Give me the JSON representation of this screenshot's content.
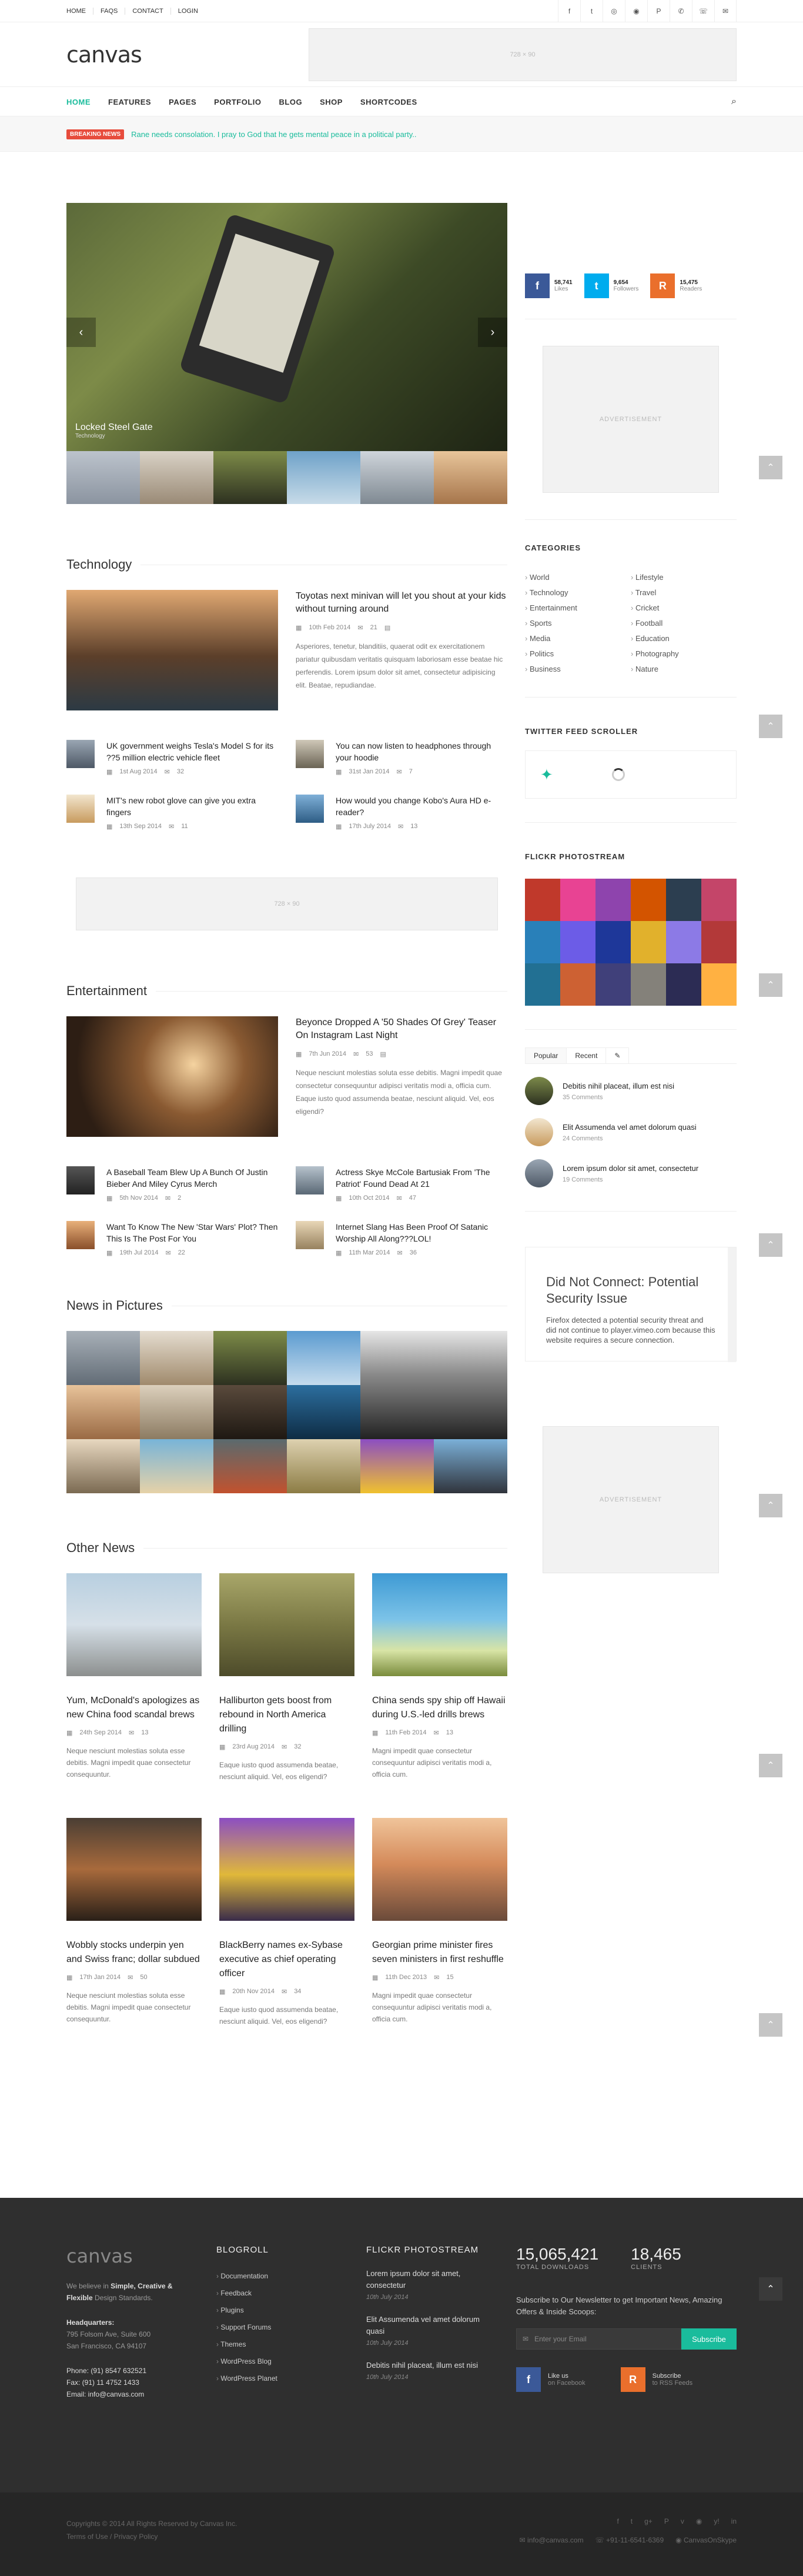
{
  "topnav": [
    "HOME",
    "FAQS",
    "CONTACT",
    "LOGIN"
  ],
  "social_icons": [
    "f",
    "t",
    "◎",
    "◉",
    "P",
    "✆",
    "☏",
    "✉"
  ],
  "logo": "canvas",
  "header_ad": "728 × 90",
  "menu": [
    "HOME",
    "FEATURES",
    "PAGES",
    "PORTFOLIO",
    "BLOG",
    "SHOP",
    "SHORTCODES"
  ],
  "breaking": {
    "badge": "BREAKING NEWS",
    "text": "Rane needs consolation. I pray to God that he gets mental peace in a political party.."
  },
  "slider": {
    "title": "Locked Steel Gate",
    "category": "Technology"
  },
  "technology": {
    "title": "Technology",
    "featured": {
      "title": "Toyotas next minivan will let you shout at your kids without turning around",
      "date": "10th Feb 2014",
      "comments": "21",
      "excerpt": "Asperiores, tenetur, blanditiis, quaerat odit ex exercitationem pariatur quibusdam veritatis quisquam laboriosam esse beatae hic perferendis. Lorem ipsum dolor sit amet, consectetur adipisicing elit. Beatae, repudiandae."
    },
    "posts": [
      {
        "title": "UK government weighs Tesla's Model S for its ??5 million electric vehicle fleet",
        "date": "1st Aug 2014",
        "comments": "32"
      },
      {
        "title": "You can now listen to headphones through your hoodie",
        "date": "31st Jan 2014",
        "comments": "7"
      },
      {
        "title": "MIT's new robot glove can give you extra fingers",
        "date": "13th Sep 2014",
        "comments": "11"
      },
      {
        "title": "How would you change Kobo's Aura HD e-reader?",
        "date": "17th July 2014",
        "comments": "13"
      }
    ]
  },
  "mid_ad": "728 × 90",
  "entertainment": {
    "title": "Entertainment",
    "featured": {
      "title": "Beyonce Dropped A '50 Shades Of Grey' Teaser On Instagram Last Night",
      "date": "7th Jun 2014",
      "comments": "53",
      "excerpt": "Neque nesciunt molestias soluta esse debitis. Magni impedit quae consectetur consequuntur adipisci veritatis modi a, officia cum. Eaque iusto quod assumenda beatae, nesciunt aliquid. Vel, eos eligendi?"
    },
    "posts": [
      {
        "title": "A Baseball Team Blew Up A Bunch Of Justin Bieber And Miley Cyrus Merch",
        "date": "5th Nov 2014",
        "comments": "2"
      },
      {
        "title": "Actress Skye McCole Bartusiak From 'The Patriot' Found Dead At 21",
        "date": "10th Oct 2014",
        "comments": "47"
      },
      {
        "title": "Want To Know The New 'Star Wars' Plot? Then This Is The Post For You",
        "date": "19th Jul 2014",
        "comments": "22"
      },
      {
        "title": "Internet Slang Has Been Proof Of Satanic Worship All Along???LOL!",
        "date": "11th Mar 2014",
        "comments": "36"
      }
    ]
  },
  "pictures": {
    "title": "News in Pictures"
  },
  "other_news": {
    "title": "Other News",
    "posts": [
      {
        "title": "Yum, McDonald's apologizes as new China food scandal brews",
        "date": "24th Sep 2014",
        "comments": "13",
        "excerpt": "Neque nesciunt molestias soluta esse debitis. Magni impedit quae consectetur consequuntur."
      },
      {
        "title": "Halliburton gets boost from rebound in North America drilling",
        "date": "23rd Aug 2014",
        "comments": "32",
        "excerpt": "Eaque iusto quod assumenda beatae, nesciunt aliquid. Vel, eos eligendi?"
      },
      {
        "title": "China sends spy ship off Hawaii during U.S.-led drills brews",
        "date": "11th Feb 2014",
        "comments": "13",
        "excerpt": "Magni impedit quae consectetur consequuntur adipisci veritatis modi a, officia cum."
      },
      {
        "title": "Wobbly stocks underpin yen and Swiss franc; dollar subdued",
        "date": "17th Jan 2014",
        "comments": "50",
        "excerpt": "Neque nesciunt molestias soluta esse debitis. Magni impedit quae consectetur consequuntur."
      },
      {
        "title": "BlackBerry names ex-Sybase executive as chief operating officer",
        "date": "20th Nov 2014",
        "comments": "34",
        "excerpt": "Eaque iusto quod assumenda beatae, nesciunt aliquid. Vel, eos eligendi?"
      },
      {
        "title": "Georgian prime minister fires seven ministers in first reshuffle",
        "date": "11th Dec 2013",
        "comments": "15",
        "excerpt": "Magni impedit quae consectetur consequuntur adipisci veritatis modi a, officia cum."
      }
    ]
  },
  "sidebar": {
    "counters": [
      {
        "icon": "f",
        "num": "58,741",
        "label": "Likes",
        "color": "#3b5998"
      },
      {
        "icon": "t",
        "num": "9,654",
        "label": "Followers",
        "color": "#00acee"
      },
      {
        "icon": "R",
        "num": "15,475",
        "label": "Readers",
        "color": "#ea6f2c"
      }
    ],
    "ad": "ADVERTISEMENT",
    "categories_title": "CATEGORIES",
    "categories": [
      "World",
      "Lifestyle",
      "Technology",
      "Travel",
      "Entertainment",
      "Cricket",
      "Sports",
      "Football",
      "Media",
      "Education",
      "Politics",
      "Photography",
      "Business",
      "Nature"
    ],
    "twitter_title": "TWITTER FEED SCROLLER",
    "flickr_title": "FLICKR PHOTOSTREAM",
    "tabs": [
      "Popular",
      "Recent",
      "✎"
    ],
    "tab_posts": [
      {
        "title": "Debitis nihil placeat, illum est nisi",
        "comments": "35 Comments"
      },
      {
        "title": "Elit Assumenda vel amet dolorum quasi",
        "comments": "24 Comments"
      },
      {
        "title": "Lorem ipsum dolor sit amet, consectetur",
        "comments": "19 Comments"
      }
    ],
    "video": {
      "title": "Did Not Connect: Potential Security Issue",
      "desc": "Firefox detected a potential security threat and did not continue to player.vimeo.com because this website requires a secure connection."
    },
    "ad2": "ADVERTISEMENT"
  },
  "footer": {
    "logo": "canvas",
    "about_pre": "We believe in",
    "about_bold": "Simple, Creative & Flexible",
    "about_post": "Design Standards.",
    "hq_label": "Headquarters:",
    "address1": "795 Folsom Ave, Suite 600",
    "address2": "San Francisco, CA 94107",
    "phone": "Phone: (91) 8547 632521",
    "fax": "Fax: (91) 11 4752 1433",
    "email": "Email: info@canvas.com",
    "blogroll_title": "BLOGROLL",
    "blogroll": [
      "Documentation",
      "Feedback",
      "Plugins",
      "Support Forums",
      "Themes",
      "WordPress Blog",
      "WordPress Planet"
    ],
    "flickr_title": "FLICKR PHOTOSTREAM",
    "posts": [
      {
        "title": "Lorem ipsum dolor sit amet, consectetur",
        "date": "10th July 2014"
      },
      {
        "title": "Elit Assumenda vel amet dolorum quasi",
        "date": "10th July 2014"
      },
      {
        "title": "Debitis nihil placeat, illum est nisi",
        "date": "10th July 2014"
      }
    ],
    "downloads": "15,065,421",
    "downloads_label": "TOTAL DOWNLOADS",
    "clients": "18,465",
    "clients_label": "CLIENTS",
    "subscribe_text": "Subscribe to Our Newsletter to get Important News, Amazing Offers & Inside Scoops:",
    "email_placeholder": "Enter your Email",
    "subscribe_button": "Subscribe",
    "like_title": "Like us",
    "like_sub": "on Facebook",
    "rss_title": "Subscribe",
    "rss_sub": "to RSS Feeds"
  },
  "copyright": {
    "line1": "Copyrights © 2014 All Rights Reserved by Canvas Inc.",
    "line2": "Terms of Use / Privacy Policy",
    "email": "✉ info@canvas.com",
    "phone": "☏ +91-11-6541-6369",
    "skype": "◉ CanvasOnSkype"
  }
}
